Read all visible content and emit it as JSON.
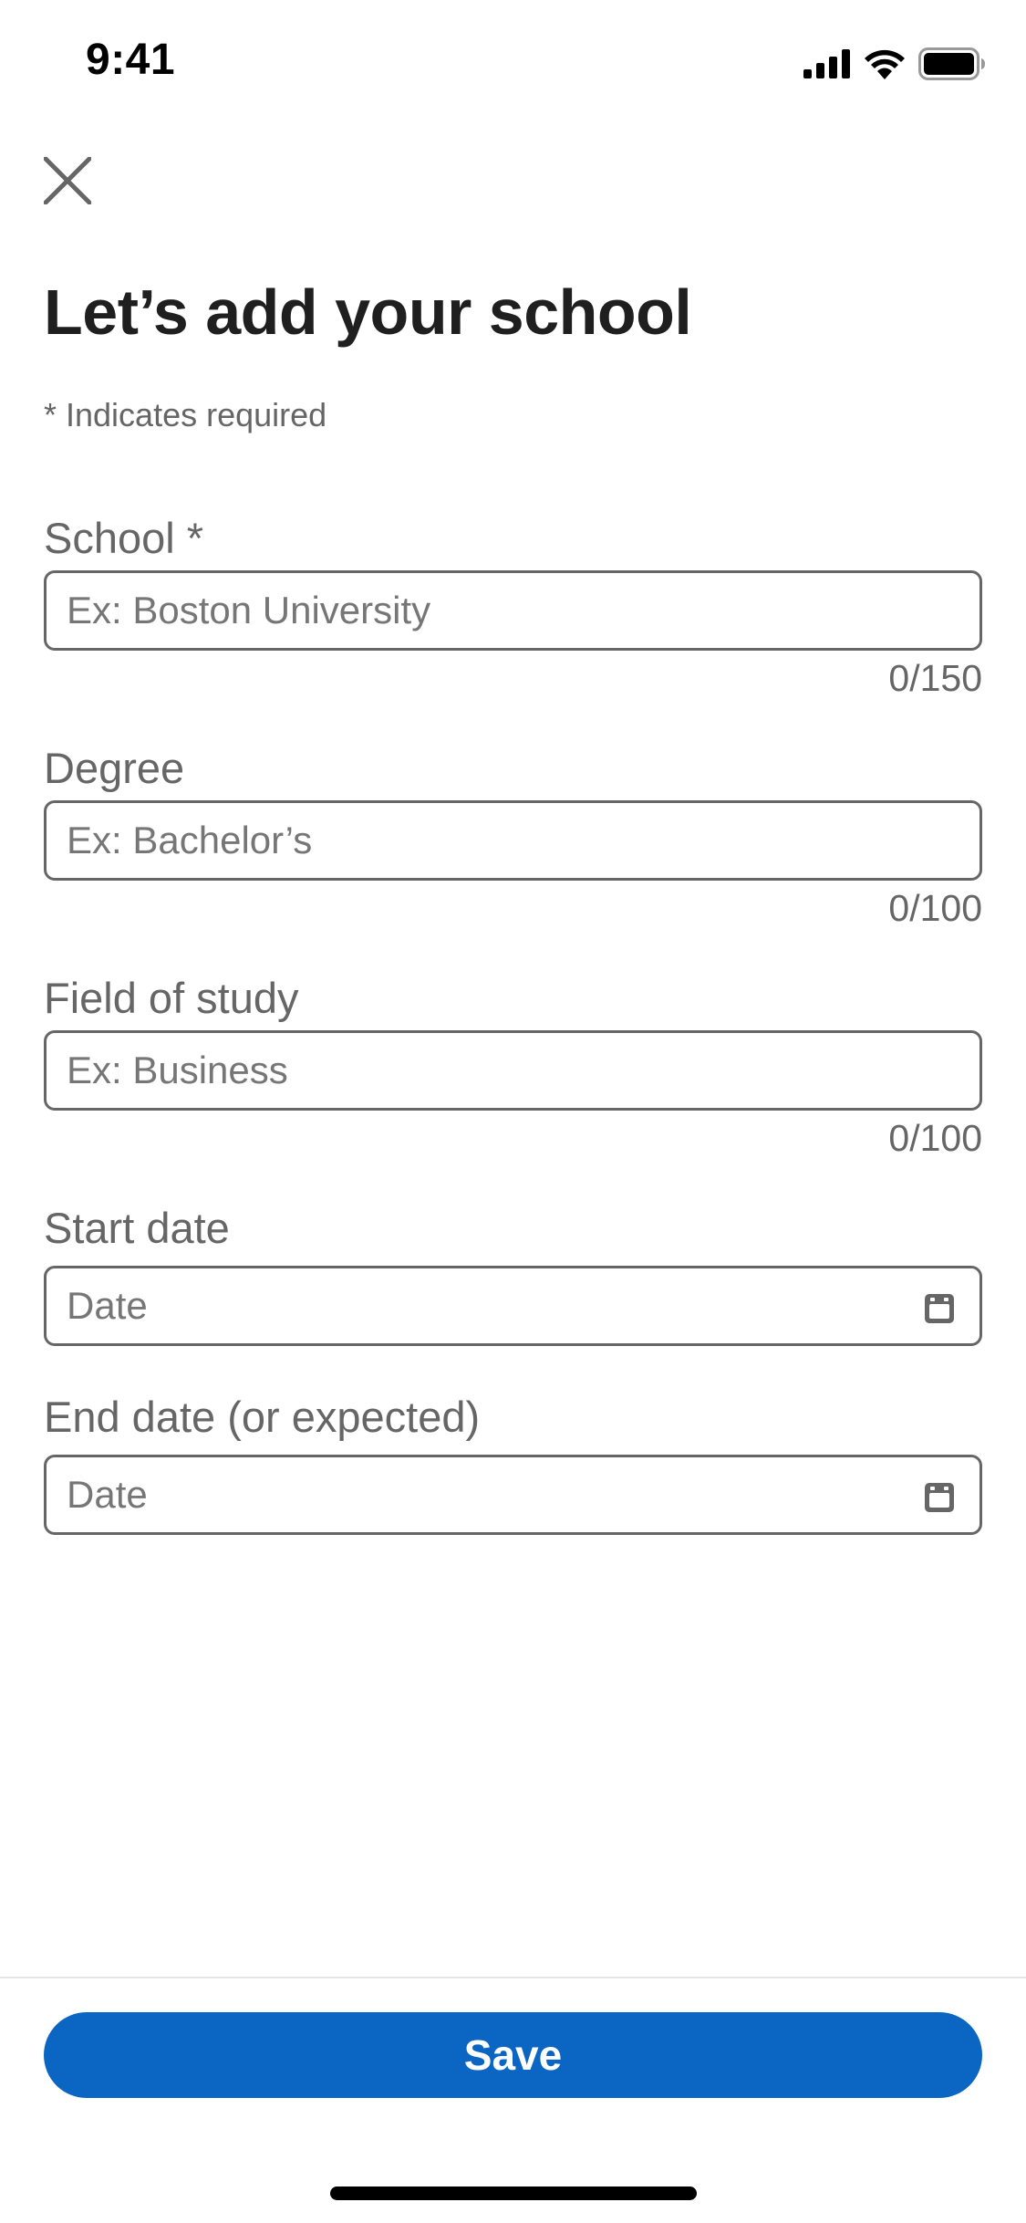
{
  "status_bar": {
    "time": "9:41"
  },
  "header": {
    "close_icon": "close-icon",
    "title": "Let’s add your school",
    "required_note": "* Indicates required"
  },
  "form": {
    "school": {
      "label": "School *",
      "placeholder": "Ex: Boston University",
      "value": "",
      "counter": "0/150"
    },
    "degree": {
      "label": "Degree",
      "placeholder": "Ex: Bachelor’s",
      "value": "",
      "counter": "0/100"
    },
    "field_of_study": {
      "label": "Field of study",
      "placeholder": "Ex: Business",
      "value": "",
      "counter": "0/100"
    },
    "start_date": {
      "label": "Start date",
      "placeholder": "Date",
      "value": "",
      "icon": "calendar-icon"
    },
    "end_date": {
      "label": "End date (or expected)",
      "placeholder": "Date",
      "value": "",
      "icon": "calendar-icon"
    }
  },
  "footer": {
    "save_label": "Save"
  },
  "colors": {
    "accent": "#0a66c2",
    "text_primary": "#1f1f1f",
    "text_secondary": "#666666",
    "border": "#666666"
  }
}
